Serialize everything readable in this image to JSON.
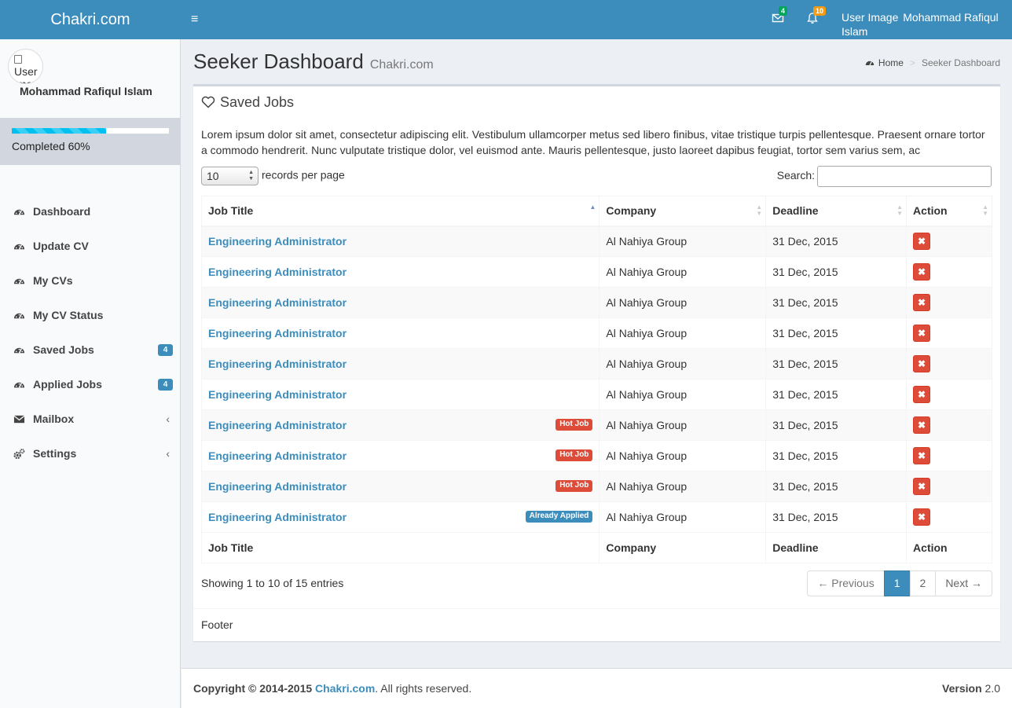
{
  "header": {
    "logo": "Chakri.com",
    "toggle_icon": "bars-icon",
    "mail_count": "4",
    "notif_count": "10",
    "user_image_alt": "User Image",
    "user_name": "Mohammad Rafiqul Islam"
  },
  "sidebar": {
    "avatar_alt": "User Image",
    "user_name": "Mohammad Rafiqul Islam",
    "progress_percent": 60,
    "progress_label": "Completed 60%",
    "items": [
      {
        "label": "Dashboard",
        "icon": "dashboard-icon"
      },
      {
        "label": "Update CV",
        "icon": "dashboard-icon"
      },
      {
        "label": "My CVs",
        "icon": "dashboard-icon"
      },
      {
        "label": "My CV Status",
        "icon": "dashboard-icon"
      },
      {
        "label": "Saved Jobs",
        "icon": "dashboard-icon",
        "badge": "4"
      },
      {
        "label": "Applied Jobs",
        "icon": "dashboard-icon",
        "badge": "4"
      },
      {
        "label": "Mailbox",
        "icon": "envelope-icon",
        "chevron": "‹"
      },
      {
        "label": "Settings",
        "icon": "cogs-icon",
        "chevron": "‹"
      }
    ]
  },
  "page": {
    "title": "Seeker Dashboard",
    "subtitle": "Chakri.com",
    "breadcrumb": {
      "home": "Home",
      "separator": ">",
      "current": "Seeker Dashboard"
    }
  },
  "box": {
    "title": "Saved Jobs",
    "description": "Lorem ipsum dolor sit amet, consectetur adipiscing elit. Vestibulum ullamcorper metus sed libero finibus, vitae tristique turpis pellentesque. Praesent ornare tortor a commodo hendrerit. Nunc vulputate tristique dolor, vel euismod ante. Mauris pellentesque, justo laoreet dapibus feugiat, tortor sem varius sem, ac",
    "length_value": "10",
    "length_label": "records per page",
    "search_label": "Search:",
    "search_value": "",
    "columns": [
      "Job Title",
      "Company",
      "Deadline",
      "Action"
    ],
    "rows": [
      {
        "title": "Engineering Administrator",
        "label": "",
        "company": "Al Nahiya Group",
        "deadline": "31 Dec, 2015"
      },
      {
        "title": "Engineering Administrator",
        "label": "",
        "company": "Al Nahiya Group",
        "deadline": "31 Dec, 2015"
      },
      {
        "title": "Engineering Administrator",
        "label": "",
        "company": "Al Nahiya Group",
        "deadline": "31 Dec, 2015"
      },
      {
        "title": "Engineering Administrator",
        "label": "",
        "company": "Al Nahiya Group",
        "deadline": "31 Dec, 2015"
      },
      {
        "title": "Engineering Administrator",
        "label": "",
        "company": "Al Nahiya Group",
        "deadline": "31 Dec, 2015"
      },
      {
        "title": "Engineering Administrator",
        "label": "",
        "company": "Al Nahiya Group",
        "deadline": "31 Dec, 2015"
      },
      {
        "title": "Engineering Administrator",
        "label": "Hot Job",
        "company": "Al Nahiya Group",
        "deadline": "31 Dec, 2015"
      },
      {
        "title": "Engineering Administrator",
        "label": "Hot Job",
        "company": "Al Nahiya Group",
        "deadline": "31 Dec, 2015"
      },
      {
        "title": "Engineering Administrator",
        "label": "Hot Job",
        "company": "Al Nahiya Group",
        "deadline": "31 Dec, 2015"
      },
      {
        "title": "Engineering Administrator",
        "label": "Already Applied",
        "company": "Al Nahiya Group",
        "deadline": "31 Dec, 2015"
      }
    ],
    "delete_icon": "✖",
    "info": "Showing 1 to 10 of 15 entries",
    "pagination": {
      "previous": "← Previous",
      "pages": [
        "1",
        "2"
      ],
      "active": "1",
      "next": "Next →"
    },
    "footer": "Footer"
  },
  "footer": {
    "copyright_prefix": "Copyright © 2014-2015",
    "brand": "Chakri.com",
    "copyright_suffix": ". All rights reserved.",
    "version_label": "Version",
    "version": "2.0"
  },
  "colors": {
    "brand": "#3c8dbc",
    "danger": "#dd4b39",
    "success": "#00a65a",
    "warning": "#f39c12",
    "progress": "#00c0ef"
  }
}
